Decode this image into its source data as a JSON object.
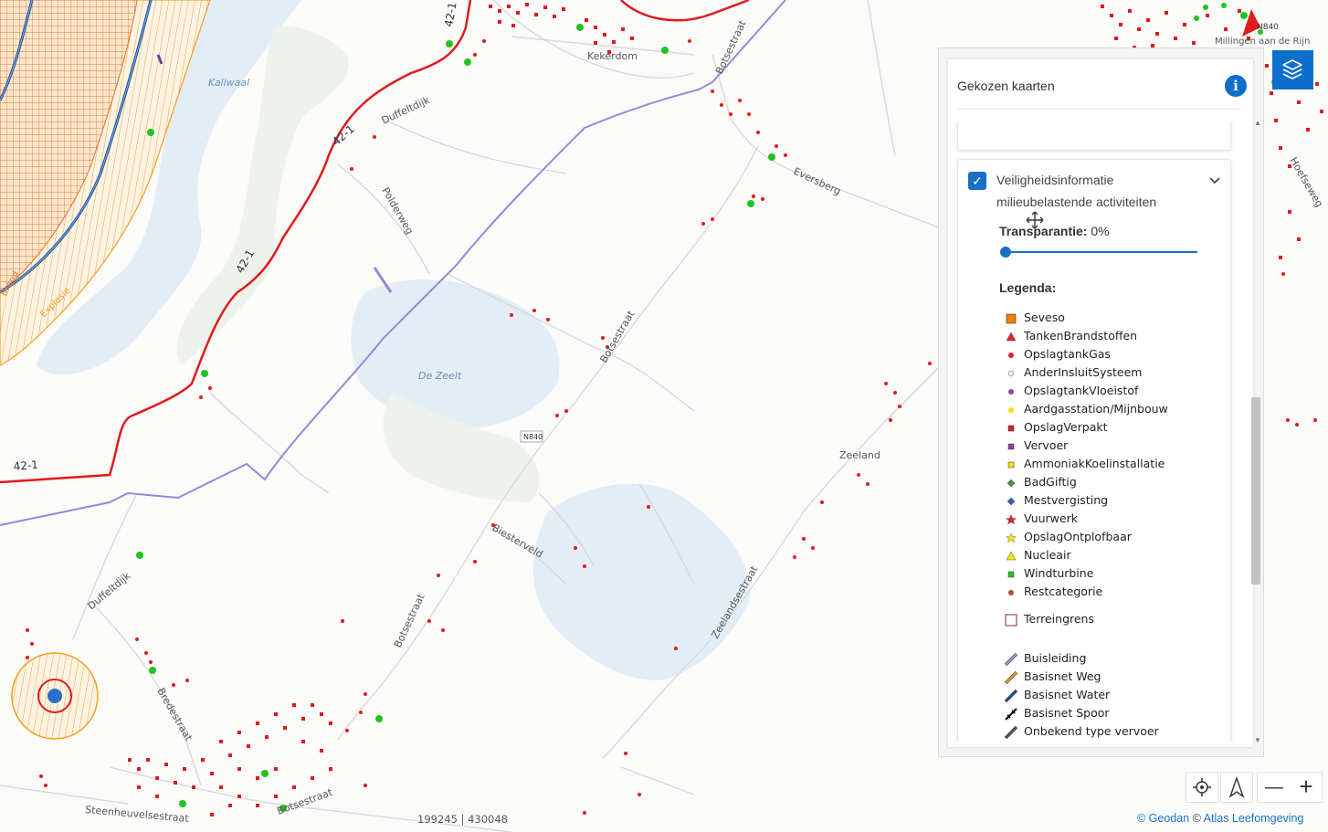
{
  "map": {
    "labels": {
      "kaliwaal": "Kaliwaal",
      "kekerdom": "Kekerdom",
      "millingen": "Millingen aan de Rijn",
      "de_zeelt": "De Zeelt",
      "zeeland": "Zeeland",
      "n840_badge": "N840",
      "n840_top": "N840",
      "duffeltdijk_top": "Duffeltdijk",
      "duffeltdijk_bottom": "Duffeltdijk",
      "polderweg": "Polderweg",
      "botsestraat_top": "Botsestraat",
      "botsestraat_mid": "Botsestraat",
      "botsestraat_low": "Botsestraat",
      "botsestraat_bottom": "Botsestraat",
      "eversberg": "Eversberg",
      "biesterveld": "Biesterveld",
      "zeelandsestraat": "Zeelandsestraat",
      "bredestraat": "Bredestraat",
      "steenheuvelsestraat": "Steenheuvelsestraat",
      "hoefseweg": "Hoefseweg",
      "route_421_a": "42-1",
      "route_421_b": "42-1",
      "route_421_c": "42-1",
      "route_421_d": "42-1",
      "explosie": "Explosie",
      "brand": "Brand"
    }
  },
  "panel": {
    "title": "Gekozen kaarten",
    "info_icon": "info-icon",
    "layer": {
      "name_line1": "Veiligheidsinformatie",
      "name_line2": "milieubelastende activiteiten",
      "checked": true
    },
    "transparency_label": "Transparantie:",
    "transparency_value": "0%",
    "transparency_fraction": 0,
    "legend_title": "Legenda:",
    "legend": [
      {
        "label": "Seveso",
        "symbol": "square",
        "color": "#f07c00"
      },
      {
        "label": "TankenBrandstoffen",
        "symbol": "triangle",
        "color": "#e8202a"
      },
      {
        "label": "OpslagtankGas",
        "symbol": "dot",
        "color": "#e8202a"
      },
      {
        "label": "AnderInsluitSysteem",
        "symbol": "circle-open",
        "color": "#888888"
      },
      {
        "label": "OpslagtankVloeistof",
        "symbol": "dot",
        "color": "#8a4a9c"
      },
      {
        "label": "Aardgasstation/Mijnbouw",
        "symbol": "dot",
        "color": "#f2e400"
      },
      {
        "label": "OpslagVerpakt",
        "symbol": "small-square",
        "color": "#d2202a"
      },
      {
        "label": "Vervoer",
        "symbol": "small-square",
        "color": "#8a4a9c"
      },
      {
        "label": "AmmoniakKoelinstallatie",
        "symbol": "small-square",
        "color": "#f2e400"
      },
      {
        "label": "BadGiftig",
        "symbol": "diamond",
        "color": "#3f9a3f"
      },
      {
        "label": "Mestvergisting",
        "symbol": "diamond",
        "color": "#3a5fa8"
      },
      {
        "label": "Vuurwerk",
        "symbol": "star",
        "color": "#e8202a"
      },
      {
        "label": "OpslagOntplofbaar",
        "symbol": "star",
        "color": "#f2e400"
      },
      {
        "label": "Nucleair",
        "symbol": "triangle",
        "color": "#f2e400"
      },
      {
        "label": "Windturbine",
        "symbol": "small-square",
        "color": "#22c222"
      },
      {
        "label": "Restcategorie",
        "symbol": "dot",
        "color": "#b04a3a"
      }
    ],
    "terrain_label": "Terreingrens",
    "transport": [
      {
        "label": "Buisleiding",
        "color": "#a98fe0",
        "kind": "line"
      },
      {
        "label": "Basisnet Weg",
        "color": "#f0a020",
        "kind": "line"
      },
      {
        "label": "Basisnet Water",
        "color": "#1f4f9a",
        "kind": "line"
      },
      {
        "label": "Basisnet Spoor",
        "color": "#111111",
        "kind": "rail"
      },
      {
        "label": "Onbekend type vervoer",
        "color": "#555555",
        "kind": "line"
      }
    ]
  },
  "controls": {
    "locate_icon": "locate-icon",
    "north_icon": "compass-north-icon",
    "zoom_out_label": "—",
    "zoom_in_label": "+"
  },
  "coordinates": "199245 | 430048",
  "attribution": {
    "geodan": "© Geodan",
    "separator": "©",
    "atlas": "Atlas Leefomgeving"
  },
  "colors": {
    "accent": "#0b6fcb",
    "hazard_red": "#e11a1a",
    "pipeline_purple": "#9c86d8",
    "water_blue": "#e3edf5"
  }
}
